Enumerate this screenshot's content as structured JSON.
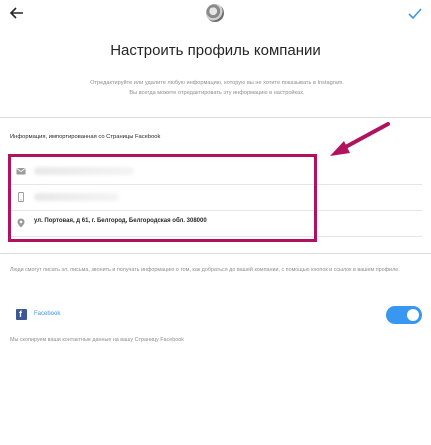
{
  "header": {
    "title": "Настроить профиль компании"
  },
  "description": [
    "Отредактируйте или удалите любую информацию, которую вы не хотите показывать в Instagram.",
    "Вы всегда можете отредактировать эту информацию в настройках."
  ],
  "section": {
    "label": "Информация, импортированная со Страницы Facebook"
  },
  "contact": {
    "email": {
      "icon": "mail-icon",
      "value": ""
    },
    "phone": {
      "icon": "phone-icon",
      "value": ""
    },
    "address": {
      "icon": "location-pin-icon",
      "value": "ул. Портовая, д 61, г. Белгород, Белгородская обл. 308000"
    }
  },
  "note_contact": "Люди смогут писать эл. письма, звонить и получать информацию о том, как добраться до вашей компании, с помощью кнопок и ссылок в вашем профиле.",
  "facebook": {
    "label": "Facebook",
    "toggle_on": true
  },
  "note_facebook": "Мы скопируем ваши контактные данные на вашу Страницу Facebook",
  "colors": {
    "accent": "#3897f0",
    "highlight": "#b0125f",
    "facebook": "#3b5998"
  }
}
